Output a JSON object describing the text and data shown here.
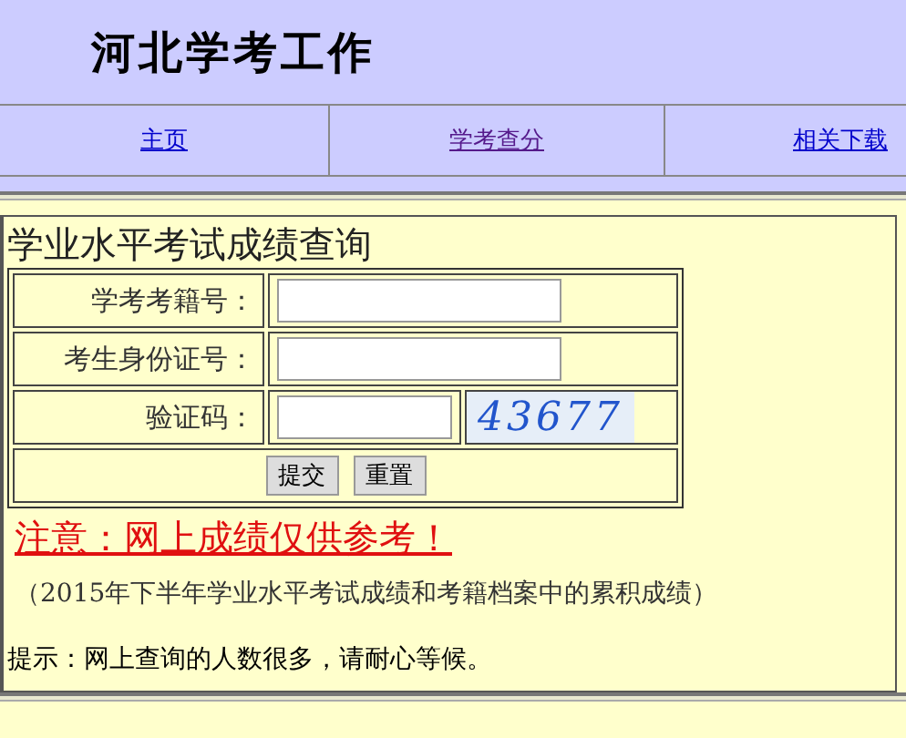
{
  "header": {
    "title": "河北学考工作"
  },
  "nav": [
    {
      "label": "主页",
      "visited": false
    },
    {
      "label": "学考查分",
      "visited": true
    },
    {
      "label": "相关下载",
      "visited": false
    }
  ],
  "form": {
    "title": "学业水平考试成绩查询",
    "fields": [
      {
        "kind": "text",
        "label": "学考考籍号："
      },
      {
        "kind": "text",
        "label": "考生身份证号："
      },
      {
        "kind": "captcha",
        "label": "验证码：",
        "captcha": "43677"
      }
    ],
    "buttons": [
      "提交",
      "重置"
    ]
  },
  "notice": "注意：网上成绩仅供参考！",
  "note": "（2015年下半年学业水平考试成绩和考籍档案中的累积成绩）",
  "hint": "提示：网上查询的人数很多，请耐心等候。"
}
